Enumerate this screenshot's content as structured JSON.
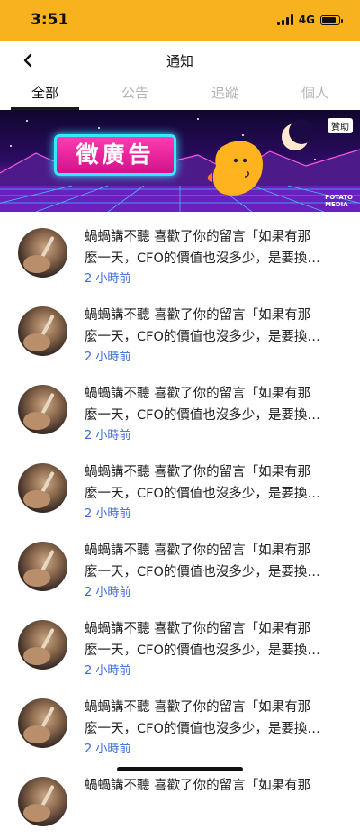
{
  "status_bar": {
    "time": "3:51",
    "network": "4G"
  },
  "header": {
    "title": "通知"
  },
  "tabs": [
    {
      "label": "全部"
    },
    {
      "label": "公告"
    },
    {
      "label": "追蹤"
    },
    {
      "label": "個人"
    }
  ],
  "banner": {
    "title": "徵廣告",
    "sponsor_tag": "贊助",
    "brand_line1": "POTATO",
    "brand_line2": "MEDIA"
  },
  "notifications": [
    {
      "line1": "蝸蝸講不聽 喜歡了你的留言「如果有那",
      "line2": "麼一天，CFO的價值也沒多少，是要換…",
      "time": "2 小時前"
    },
    {
      "line1": "蝸蝸講不聽 喜歡了你的留言「如果有那",
      "line2": "麼一天，CFO的價值也沒多少，是要換…",
      "time": "2 小時前"
    },
    {
      "line1": "蝸蝸講不聽 喜歡了你的留言「如果有那",
      "line2": "麼一天，CFO的價值也沒多少，是要換…",
      "time": "2 小時前"
    },
    {
      "line1": "蝸蝸講不聽 喜歡了你的留言「如果有那",
      "line2": "麼一天，CFO的價值也沒多少，是要換…",
      "time": "2 小時前"
    },
    {
      "line1": "蝸蝸講不聽 喜歡了你的留言「如果有那",
      "line2": "麼一天，CFO的價值也沒多少，是要換…",
      "time": "2 小時前"
    },
    {
      "line1": "蝸蝸講不聽 喜歡了你的留言「如果有那",
      "line2": "麼一天，CFO的價值也沒多少，是要換…",
      "time": "2 小時前"
    },
    {
      "line1": "蝸蝸講不聽 喜歡了你的留言「如果有那",
      "line2": "麼一天，CFO的價值也沒多少，是要換…",
      "time": "2 小時前"
    },
    {
      "line1": "蝸蝸講不聽 喜歡了你的留言「如果有那",
      "line2": "",
      "time": ""
    }
  ],
  "colors": {
    "status_bar": "#f7b21e",
    "time_text": "#3b6bd6",
    "active_tab": "#111111"
  }
}
